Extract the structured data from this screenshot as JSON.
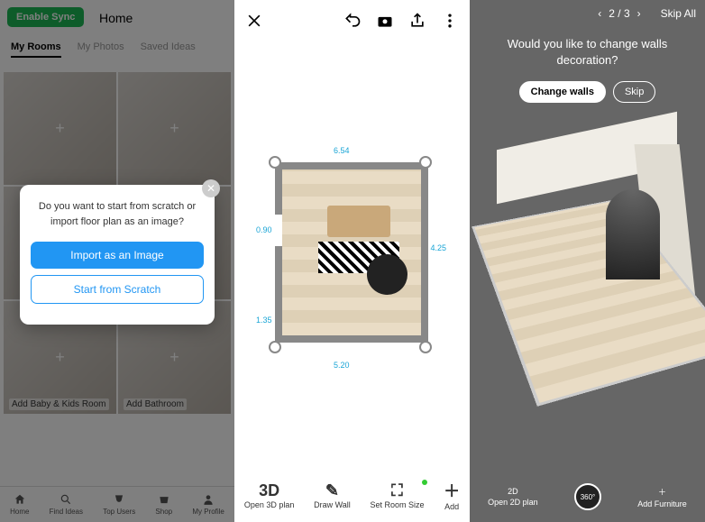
{
  "c1": {
    "sync": "Enable Sync",
    "home": "Home",
    "tabs": [
      "My Rooms",
      "My Photos",
      "Saved Ideas"
    ],
    "tiles": [
      "",
      "",
      "",
      "",
      "Add Baby & Kids Room",
      "Add Bathroom"
    ],
    "modal": {
      "prompt": "Do you want to start from scratch or import floor plan as an image?",
      "import": "Import as an Image",
      "scratch": "Start from Scratch"
    },
    "nav": [
      "Home",
      "Find Ideas",
      "Top Users",
      "Shop",
      "My Profile"
    ]
  },
  "c2": {
    "dims": {
      "top": "6.54",
      "right": "4.25",
      "bottomInner": "5.20",
      "leftLower": "1.35",
      "leftGap": "0.90"
    },
    "bot": [
      {
        "big": "3D",
        "label": "Open 3D plan"
      },
      {
        "label": "Draw Wall"
      },
      {
        "label": "Set Room Size"
      },
      {
        "label": "Add"
      }
    ]
  },
  "c3": {
    "page": "2 / 3",
    "skipAll": "Skip All",
    "prompt": "Would you like to change walls decoration?",
    "change": "Change walls",
    "skip": "Skip",
    "bot": [
      {
        "big": "2D",
        "label": "Open 2D plan"
      },
      {
        "knob": "360°"
      },
      {
        "label": "Add Furniture"
      }
    ]
  }
}
